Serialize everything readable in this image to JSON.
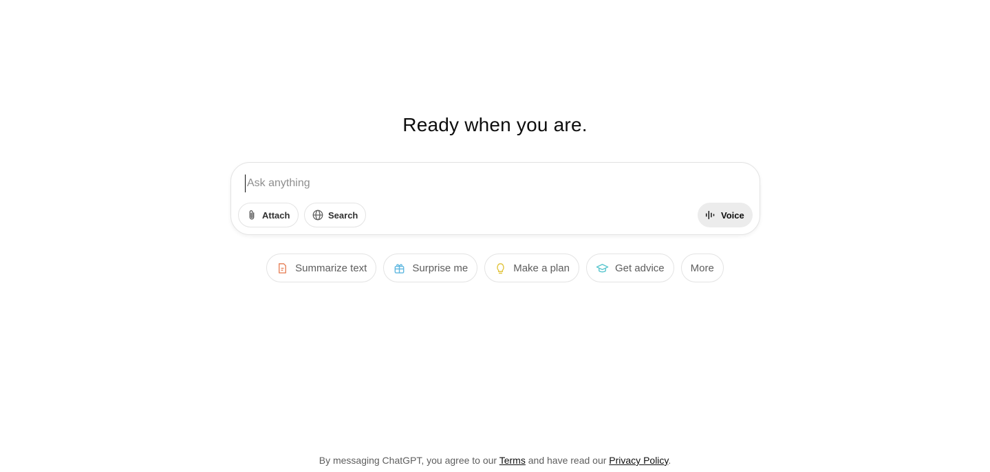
{
  "headline": "Ready when you are.",
  "composer": {
    "placeholder": "Ask anything",
    "value": "",
    "attach_label": "Attach",
    "attach_icon": "paperclip-icon",
    "search_label": "Search",
    "search_icon": "globe-icon",
    "voice_label": "Voice",
    "voice_icon": "waveform-icon"
  },
  "chips": [
    {
      "label": "Summarize text",
      "icon": "document-icon",
      "color": "#e8845c"
    },
    {
      "label": "Surprise me",
      "icon": "gift-icon",
      "color": "#5fb7e0"
    },
    {
      "label": "Make a plan",
      "icon": "lightbulb-icon",
      "color": "#e2c541"
    },
    {
      "label": "Get advice",
      "icon": "graduation-cap-icon",
      "color": "#5cc7cf"
    },
    {
      "label": "More",
      "icon": "",
      "color": ""
    }
  ],
  "footer": {
    "prefix": "By messaging ChatGPT, you agree to our ",
    "terms_label": "Terms",
    "middle": " and have read our ",
    "privacy_label": "Privacy Policy",
    "suffix": "."
  }
}
